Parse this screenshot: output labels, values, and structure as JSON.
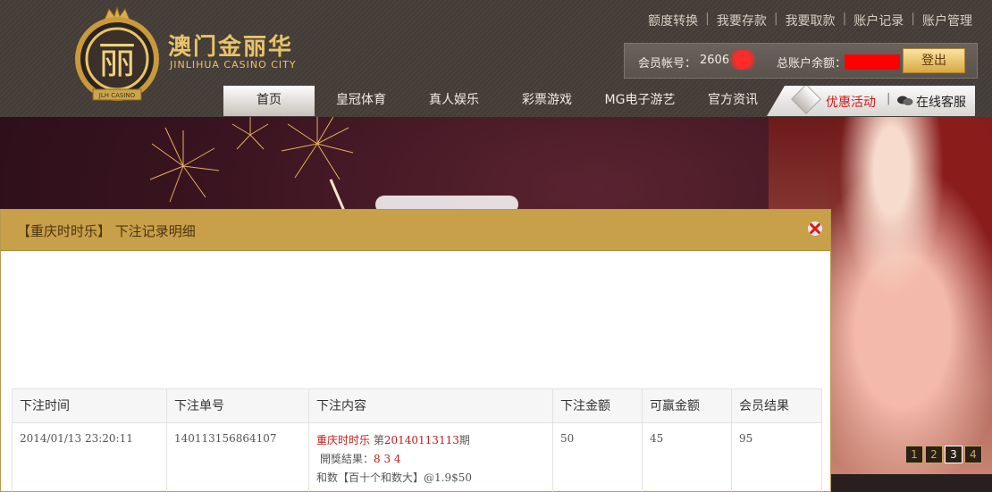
{
  "brand": {
    "name_cn": "澳门金丽华",
    "name_en": "JINLIHUA CASINO CITY",
    "emblem_char": "丽",
    "ribbon_text": "JLH CASINO",
    "colors": {
      "gold": "#e7c36a",
      "header_bg": "#463e38",
      "modal_header": "#c8a04a",
      "accent_red": "#c81818"
    }
  },
  "top_links": [
    "额度转换",
    "我要存款",
    "我要取款",
    "账户记录",
    "账户管理"
  ],
  "account": {
    "member_label": "会员帐号：",
    "member_value": "2606",
    "balance_label": "总账户余额：",
    "logout_label": "登出"
  },
  "nav": {
    "items": [
      "首页",
      "皇冠体育",
      "真人娱乐",
      "彩票游戏",
      "MG电子游艺",
      "官方资讯"
    ],
    "active_index": 0,
    "promo_label": "优惠活动",
    "service_label": "在线客服"
  },
  "banner": {
    "pages": [
      "1",
      "2",
      "3",
      "4"
    ],
    "active_page": "3"
  },
  "modal": {
    "title": "【重庆时时乐】 下注记录明细",
    "close_icon": "close-x-icon",
    "table": {
      "headers": [
        "下注时间",
        "下注单号",
        "下注内容",
        "下注金额",
        "可赢金额",
        "会员结果"
      ],
      "rows": [
        {
          "time": "2014/01/13 23:20:11",
          "order_no": "140113156864107",
          "game": "重庆时时乐",
          "period_prefix": "第",
          "period": "20140113113",
          "period_suffix": "期",
          "result_label": "開獎結果：",
          "result_numbers": "8 3 4",
          "bet_detail": "和数【百十个和数大】@1.9$50",
          "amount": "50",
          "winnable": "45",
          "member_result": "95"
        }
      ]
    }
  }
}
